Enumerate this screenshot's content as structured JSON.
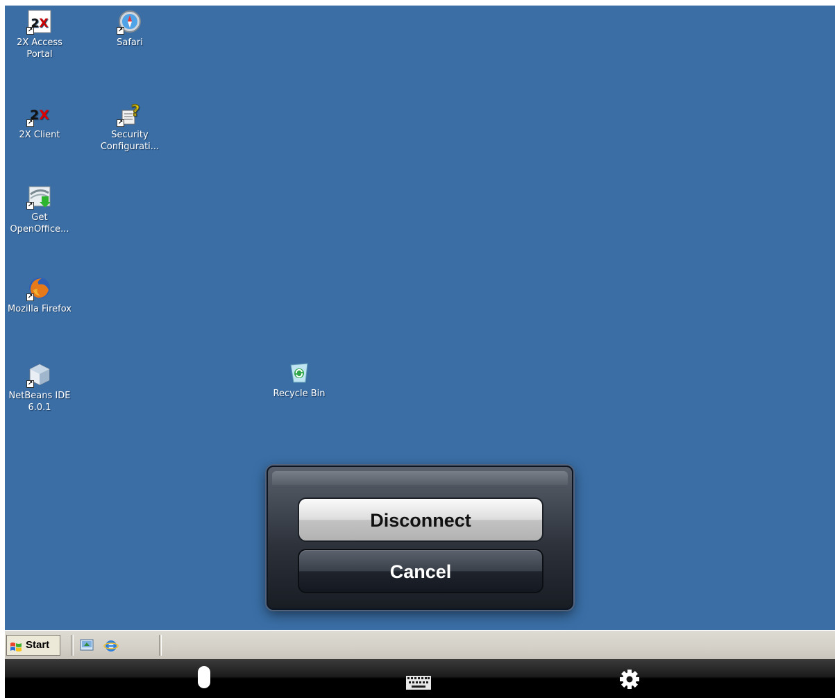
{
  "desktop": {
    "background": "#3a6ea5",
    "icons": [
      {
        "label": "2X Access\nPortal",
        "icon": "2x-access-portal-icon"
      },
      {
        "label": "Safari",
        "icon": "safari-icon"
      },
      {
        "label": "2X Client",
        "icon": "2x-client-icon"
      },
      {
        "label": "Security\nConfigurati...",
        "icon": "security-configuration-icon"
      },
      {
        "label": "Get\nOpenOffice...",
        "icon": "openoffice-icon"
      },
      {
        "label": "Mozilla Firefox",
        "icon": "firefox-icon"
      },
      {
        "label": "NetBeans IDE\n6.0.1",
        "icon": "netbeans-icon"
      },
      {
        "label": "Recycle Bin",
        "icon": "recycle-bin-icon"
      }
    ]
  },
  "dialog": {
    "disconnect_label": "Disconnect",
    "cancel_label": "Cancel"
  },
  "taskbar": {
    "start_label": "Start",
    "quick_launch": [
      "show-desktop-icon",
      "internet-explorer-icon"
    ]
  },
  "toolbar": {
    "items": [
      "mouse-icon",
      "keyboard-icon",
      "gear-icon"
    ]
  }
}
